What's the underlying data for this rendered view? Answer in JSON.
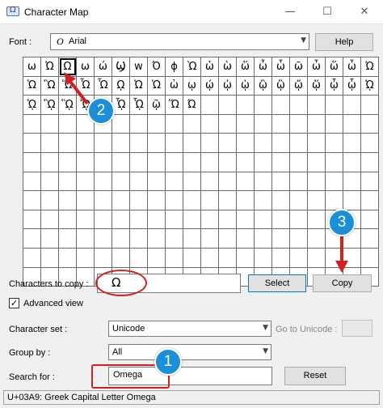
{
  "window": {
    "title": "Character Map",
    "minimize_glyph": "—",
    "maximize_glyph": "☐",
    "close_glyph": "✕"
  },
  "font": {
    "label": "Font :",
    "selected": "Arial",
    "font_type_glyph": "O",
    "help_label": "Help"
  },
  "grid": {
    "columns": 20,
    "rows": 12,
    "selected_index": 2,
    "cells": [
      "ω",
      "Ὠ",
      "Ω",
      "ω",
      "ώ",
      "Ϣ",
      "w",
      "Ό",
      "ϕ",
      "Ὼ",
      "ὡ",
      "ὼ",
      "ὥ",
      "ὦ",
      "ὧ",
      "ῶ",
      "ὦ",
      "ὥ",
      "ὦ",
      "Ὠ",
      "Ὡ",
      "Ὢ",
      "Ὥ",
      "Ὦ",
      "Ὧ",
      "ῼ",
      "Ὠ",
      "Ὡ",
      "ὡ",
      "ῳ",
      "ῴ",
      "ᾠ",
      "ᾡ",
      "ᾢ",
      "ᾣ",
      "ᾤ",
      "ᾥ",
      "ᾦ",
      "ᾧ",
      "ᾨ",
      "ᾩ",
      "ᾪ",
      "ᾫ",
      "ᾬ",
      "ᾭ",
      "ᾮ",
      "ᾯ",
      "ῷ",
      "Ὥ",
      "Ώ"
    ]
  },
  "copy_row": {
    "label": "Characters to copy :",
    "value": "Ω",
    "select_label": "Select",
    "copy_label": "Copy"
  },
  "advanced": {
    "label": "Advanced view",
    "check_glyph": "✓",
    "checked": true
  },
  "character_set": {
    "label": "Character set :",
    "value": "Unicode",
    "goto_label": "Go to Unicode :"
  },
  "group_by": {
    "label": "Group by :",
    "value": "All"
  },
  "search": {
    "label": "Search for :",
    "value": "Omega",
    "reset_label": "Reset"
  },
  "status": {
    "text": "U+03A9: Greek Capital Letter Omega"
  },
  "annotations": {
    "badge_1": "1",
    "badge_2": "2",
    "badge_3": "3",
    "accent_color": "#1b8fd8",
    "arrow_color": "#d32020"
  }
}
